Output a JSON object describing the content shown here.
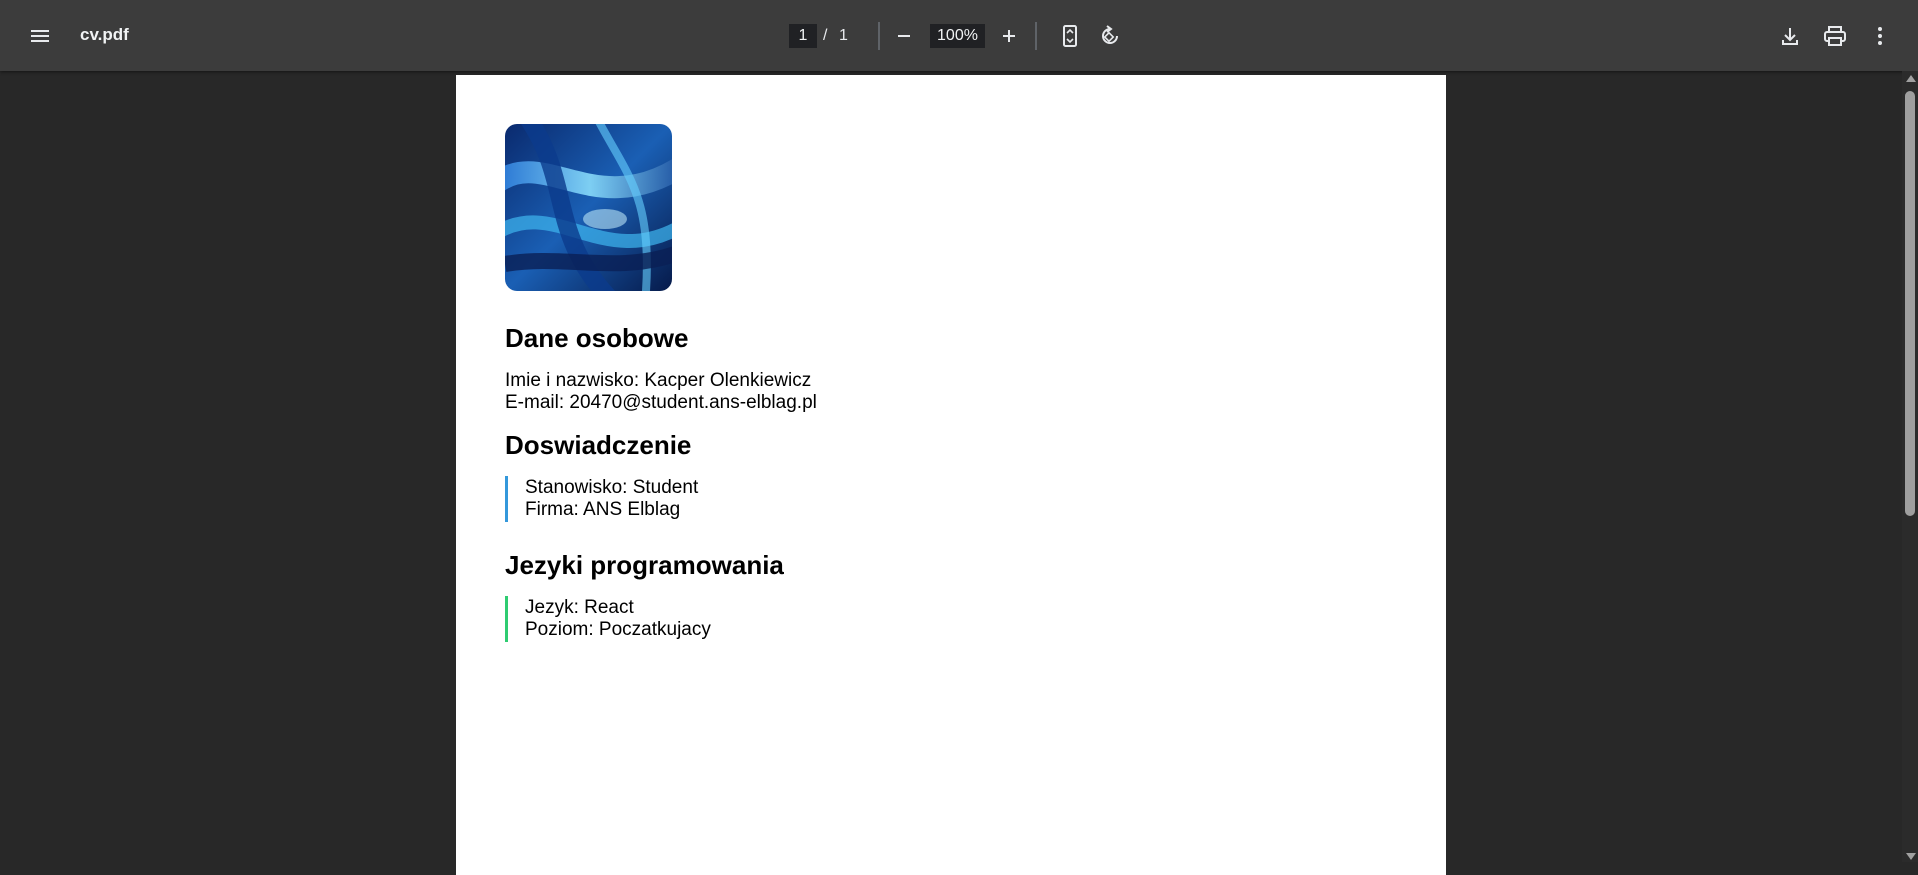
{
  "toolbar": {
    "title": "cv.pdf",
    "page_current": "1",
    "page_separator": "/",
    "page_total": "1",
    "zoom": "100%",
    "icons": {
      "menu": "menu-icon",
      "zoom_out": "minus-icon",
      "zoom_in": "plus-icon",
      "fit": "fit-to-page-icon",
      "rotate": "rotate-icon",
      "download": "download-icon",
      "print": "print-icon",
      "more": "more-vert-icon"
    }
  },
  "document": {
    "sections": {
      "personal": {
        "title": "Dane osobowe",
        "name_line": "Imie i nazwisko: Kacper Olenkiewicz",
        "email_line": "E-mail: 20470@student.ans-elblag.pl"
      },
      "experience": {
        "title": "Doswiadczenie",
        "position_line": "Stanowisko: Student",
        "company_line": "Firma: ANS Elblag",
        "accent": "#3498db"
      },
      "languages": {
        "title": "Jezyki programowania",
        "language_line": "Jezyk: React",
        "level_line": "Poziom: Poczatkujacy",
        "accent": "#2ecc71"
      }
    }
  },
  "colors": {
    "toolbar_bg": "#3c3c3c",
    "viewer_bg": "#282828",
    "page_bg": "#ffffff"
  }
}
